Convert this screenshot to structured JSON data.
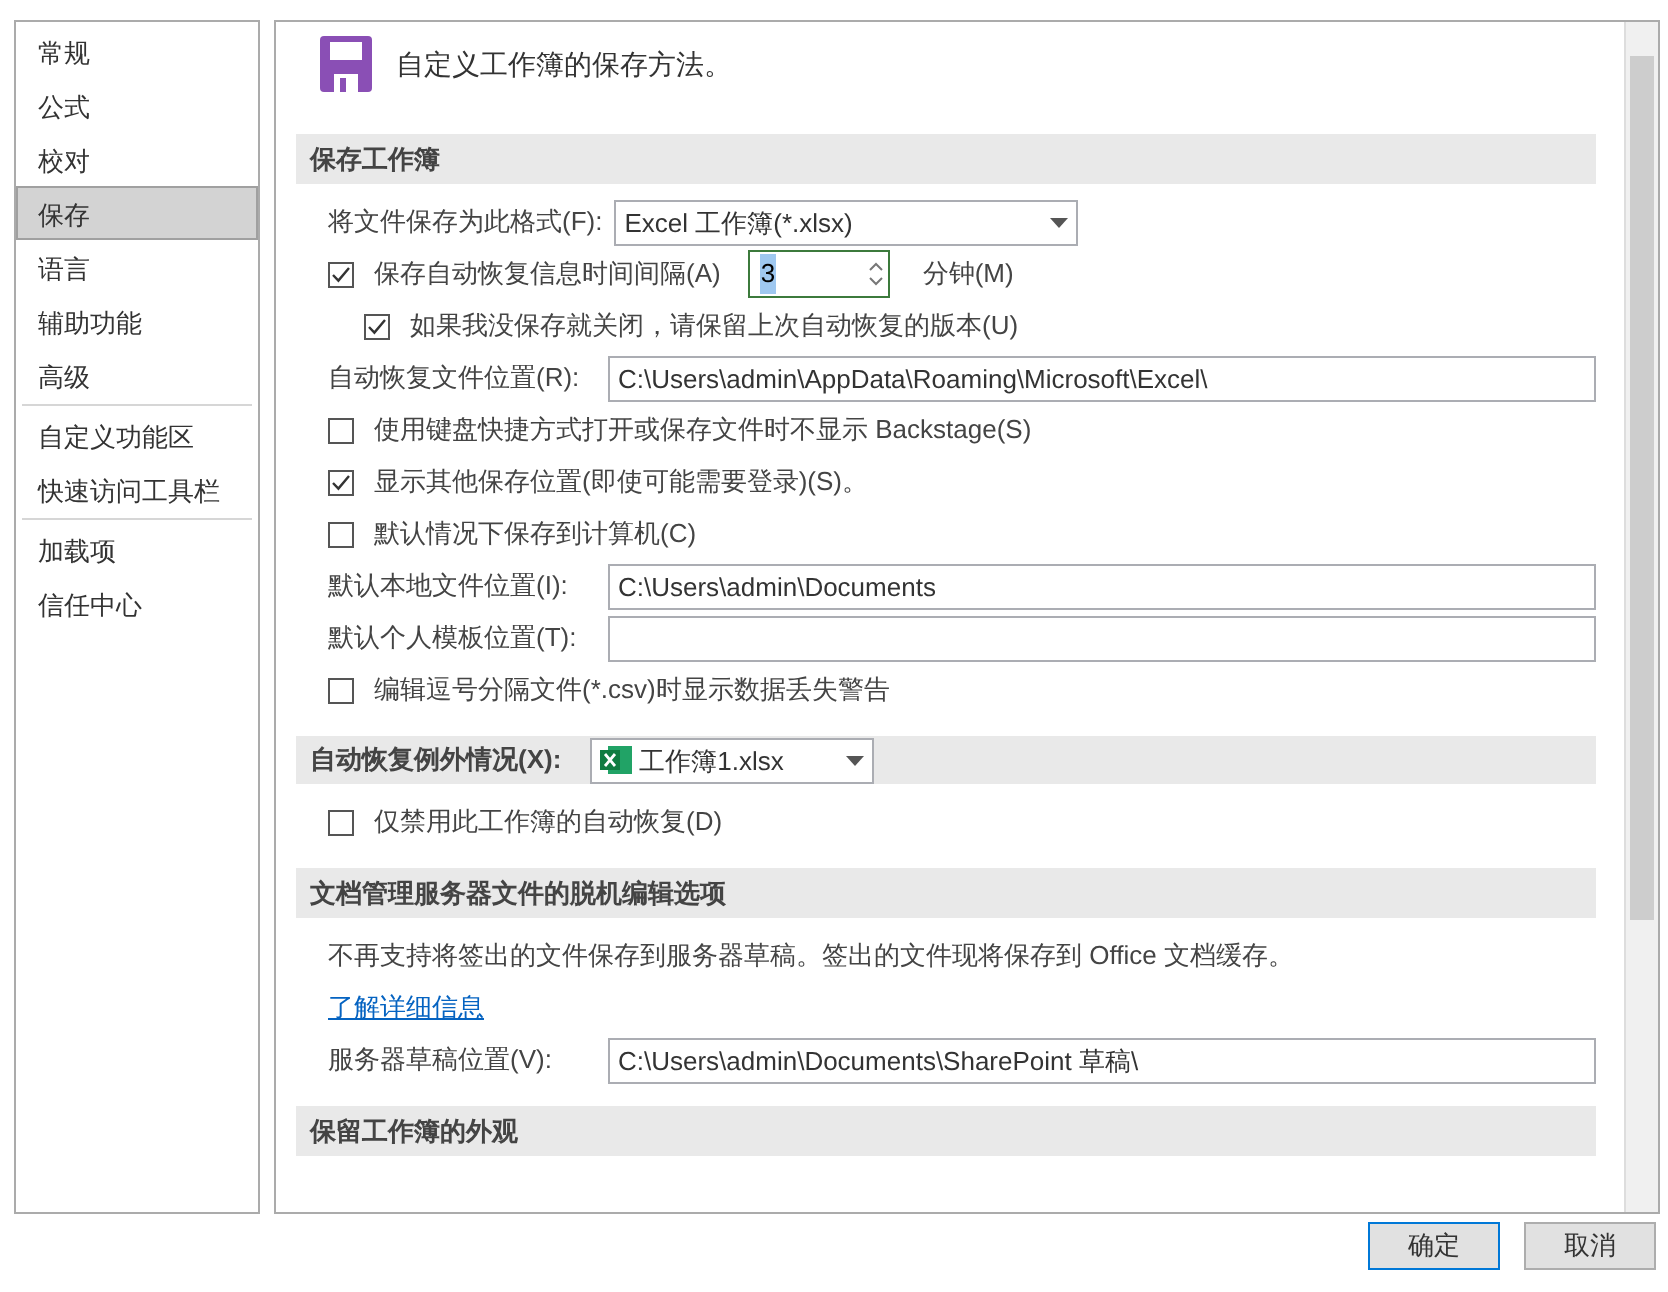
{
  "sidebar": {
    "groups": [
      [
        {
          "label": "常规",
          "selected": false
        },
        {
          "label": "公式",
          "selected": false
        },
        {
          "label": "校对",
          "selected": false
        },
        {
          "label": "保存",
          "selected": true
        },
        {
          "label": "语言",
          "selected": false
        },
        {
          "label": "辅助功能",
          "selected": false
        },
        {
          "label": "高级",
          "selected": false
        }
      ],
      [
        {
          "label": "自定义功能区",
          "selected": false
        },
        {
          "label": "快速访问工具栏",
          "selected": false
        }
      ],
      [
        {
          "label": "加载项",
          "selected": false
        },
        {
          "label": "信任中心",
          "selected": false
        }
      ]
    ]
  },
  "header": {
    "title": "自定义工作簿的保存方法。"
  },
  "sections": [
    {
      "title": "保存工作簿",
      "rows": [
        {
          "kind": "select",
          "label": "将文件保存为此格式(F):",
          "value": "Excel 工作簿(*.xlsx)"
        },
        {
          "kind": "spin",
          "label": "保存自动恢复信息时间间隔(A)",
          "checked": true,
          "value": "3",
          "value_selected": true,
          "unit": "分钟(M)",
          "children": [
            {
              "kind": "check",
              "label": "如果我没保存就关闭，请保留上次自动恢复的版本(U)",
              "checked": true
            }
          ]
        },
        {
          "kind": "input",
          "label": "自动恢复文件位置(R):",
          "value": "C:\\Users\\admin\\AppData\\Roaming\\Microsoft\\Excel\\"
        },
        {
          "kind": "check",
          "label": "使用键盘快捷方式打开或保存文件时不显示 Backstage(S)",
          "checked": false
        },
        {
          "kind": "check",
          "label": "显示其他保存位置(即使可能需要登录)(S)。",
          "checked": true
        },
        {
          "kind": "check",
          "label": "默认情况下保存到计算机(C)",
          "checked": false
        },
        {
          "kind": "input",
          "label": "默认本地文件位置(I):",
          "value": "C:\\Users\\admin\\Documents"
        },
        {
          "kind": "input",
          "label": "默认个人模板位置(T):"
        },
        {
          "kind": "check",
          "label": "编辑逗号分隔文件(*.csv)时显示数据丢失警告",
          "checked": false
        }
      ]
    },
    {
      "title": "自动恢复例外情况(X):",
      "select": {
        "value": "工作簿1.xlsx"
      },
      "rows": [
        {
          "kind": "check",
          "label": "仅禁用此工作簿的自动恢复(D)",
          "checked": false
        }
      ]
    },
    {
      "title": "文档管理服务器文件的脱机编辑选项",
      "rows": [
        {
          "kind": "text",
          "label": "不再支持将签出的文件保存到服务器草稿。签出的文件现将保存到 Office 文档缓存。"
        },
        {
          "kind": "link",
          "label": "了解详细信息"
        },
        {
          "kind": "input",
          "label": "服务器草稿位置(V):",
          "value": "C:\\Users\\admin\\Documents\\SharePoint 草稿\\"
        }
      ]
    },
    {
      "title": "保留工作簿的外观"
    }
  ],
  "buttons": [
    {
      "label": "确定"
    },
    {
      "label": "取消"
    }
  ]
}
